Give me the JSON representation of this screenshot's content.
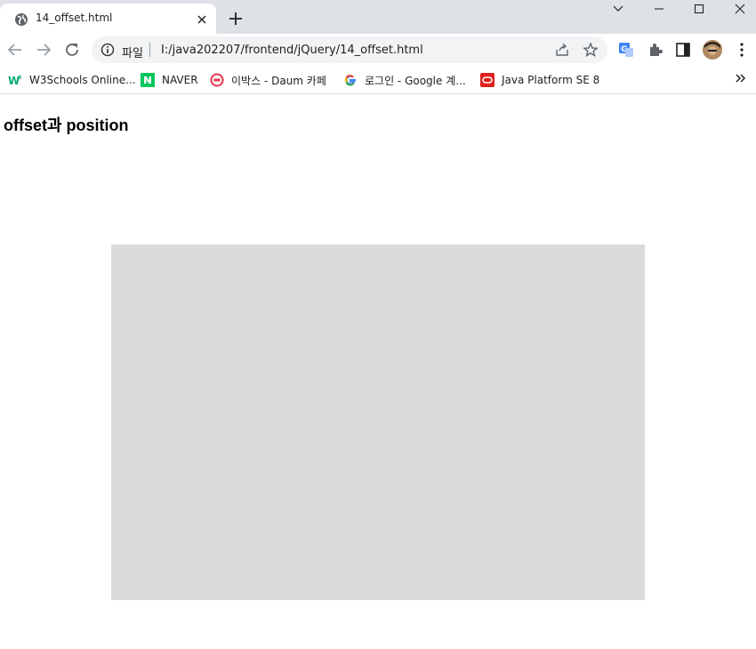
{
  "window": {
    "tab_title": "14_offset.html",
    "icons": [
      "globe-icon",
      "close-icon",
      "plus-icon",
      "chevron-down-icon",
      "minimize-icon",
      "maximize-icon",
      "close-icon"
    ]
  },
  "toolbar": {
    "scheme_label": "파일",
    "url": "I:/java202207/frontend/jQuery/14_offset.html",
    "icons": [
      "back-icon",
      "forward-icon",
      "reload-icon",
      "info-icon",
      "share-icon",
      "star-icon",
      "translate-icon",
      "extensions-icon",
      "side-panel-icon",
      "avatar",
      "menu-icon"
    ]
  },
  "bookmarks": [
    {
      "label": "W3Schools Online...",
      "icon": "w3schools-icon"
    },
    {
      "label": "NAVER",
      "icon": "naver-icon"
    },
    {
      "label": "이박스 - Daum 카페",
      "icon": "daum-cafe-icon"
    },
    {
      "label": "로그인 - Google 계...",
      "icon": "google-icon"
    },
    {
      "label": "Java Platform SE 8",
      "icon": "oracle-icon"
    }
  ],
  "page": {
    "heading": "offset과 position",
    "box_color": "#dbdbdb"
  },
  "colors": {
    "titlebar": "#dee1e6",
    "omnibox": "#f1f3f4"
  }
}
